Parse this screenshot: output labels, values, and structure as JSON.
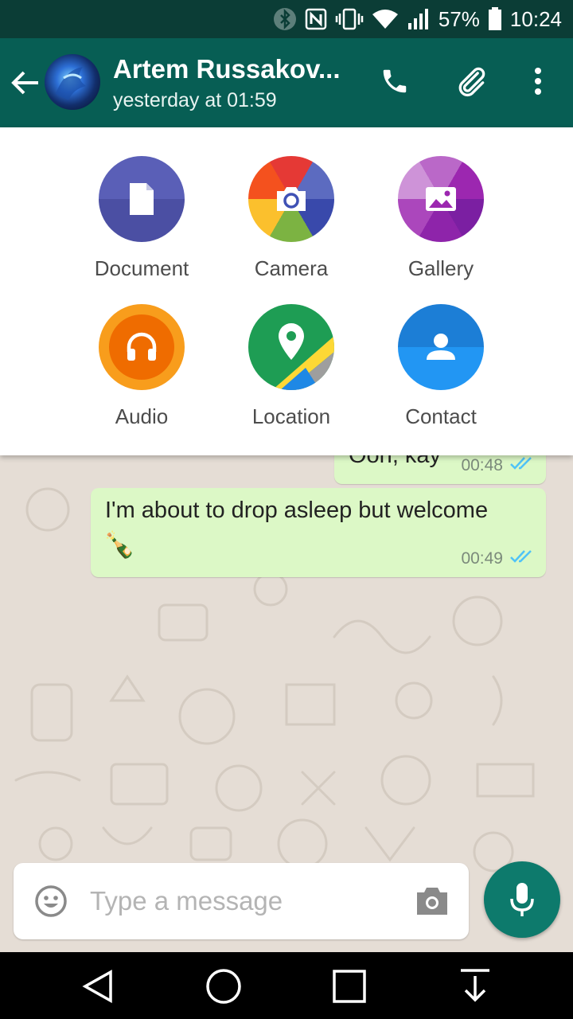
{
  "status_bar": {
    "battery_percent": "57%",
    "time": "10:24",
    "icons": [
      "bluetooth-icon",
      "nfc-icon",
      "vibrate-icon",
      "wifi-icon",
      "signal-icon",
      "battery-icon"
    ]
  },
  "header": {
    "contact_name": "Artem Russakov...",
    "last_seen": "yesterday at 01:59",
    "icons": [
      "back-arrow-icon",
      "avatar",
      "phone-icon",
      "paperclip-icon",
      "more-vert-icon"
    ],
    "color": "#075e54"
  },
  "attach_menu": {
    "items": [
      {
        "label": "Document",
        "icon": "document-icon",
        "color": "#5157ae"
      },
      {
        "label": "Camera",
        "icon": "camera-icon",
        "color": "#e84f3e"
      },
      {
        "label": "Gallery",
        "icon": "gallery-icon",
        "color": "#ab3dbe"
      },
      {
        "label": "Audio",
        "icon": "headphones-icon",
        "color": "#f57c00"
      },
      {
        "label": "Location",
        "icon": "location-pin-icon",
        "color": "#1e9d54"
      },
      {
        "label": "Contact",
        "icon": "contact-icon",
        "color": "#1e88e5"
      }
    ]
  },
  "messages": [
    {
      "text": "Oon, kay",
      "time": "00:48",
      "status": "read"
    },
    {
      "text": "I'm about to drop asleep but welcome",
      "emoji": "🍾",
      "time": "00:49",
      "status": "read"
    }
  ],
  "composer": {
    "placeholder": "Type a message",
    "value": ""
  },
  "colors": {
    "outgoing_bubble": "#dcf8c6",
    "read_ticks": "#4fc3f7",
    "mic_button": "#0d7a6c",
    "chat_background": "#e5ddd5"
  }
}
